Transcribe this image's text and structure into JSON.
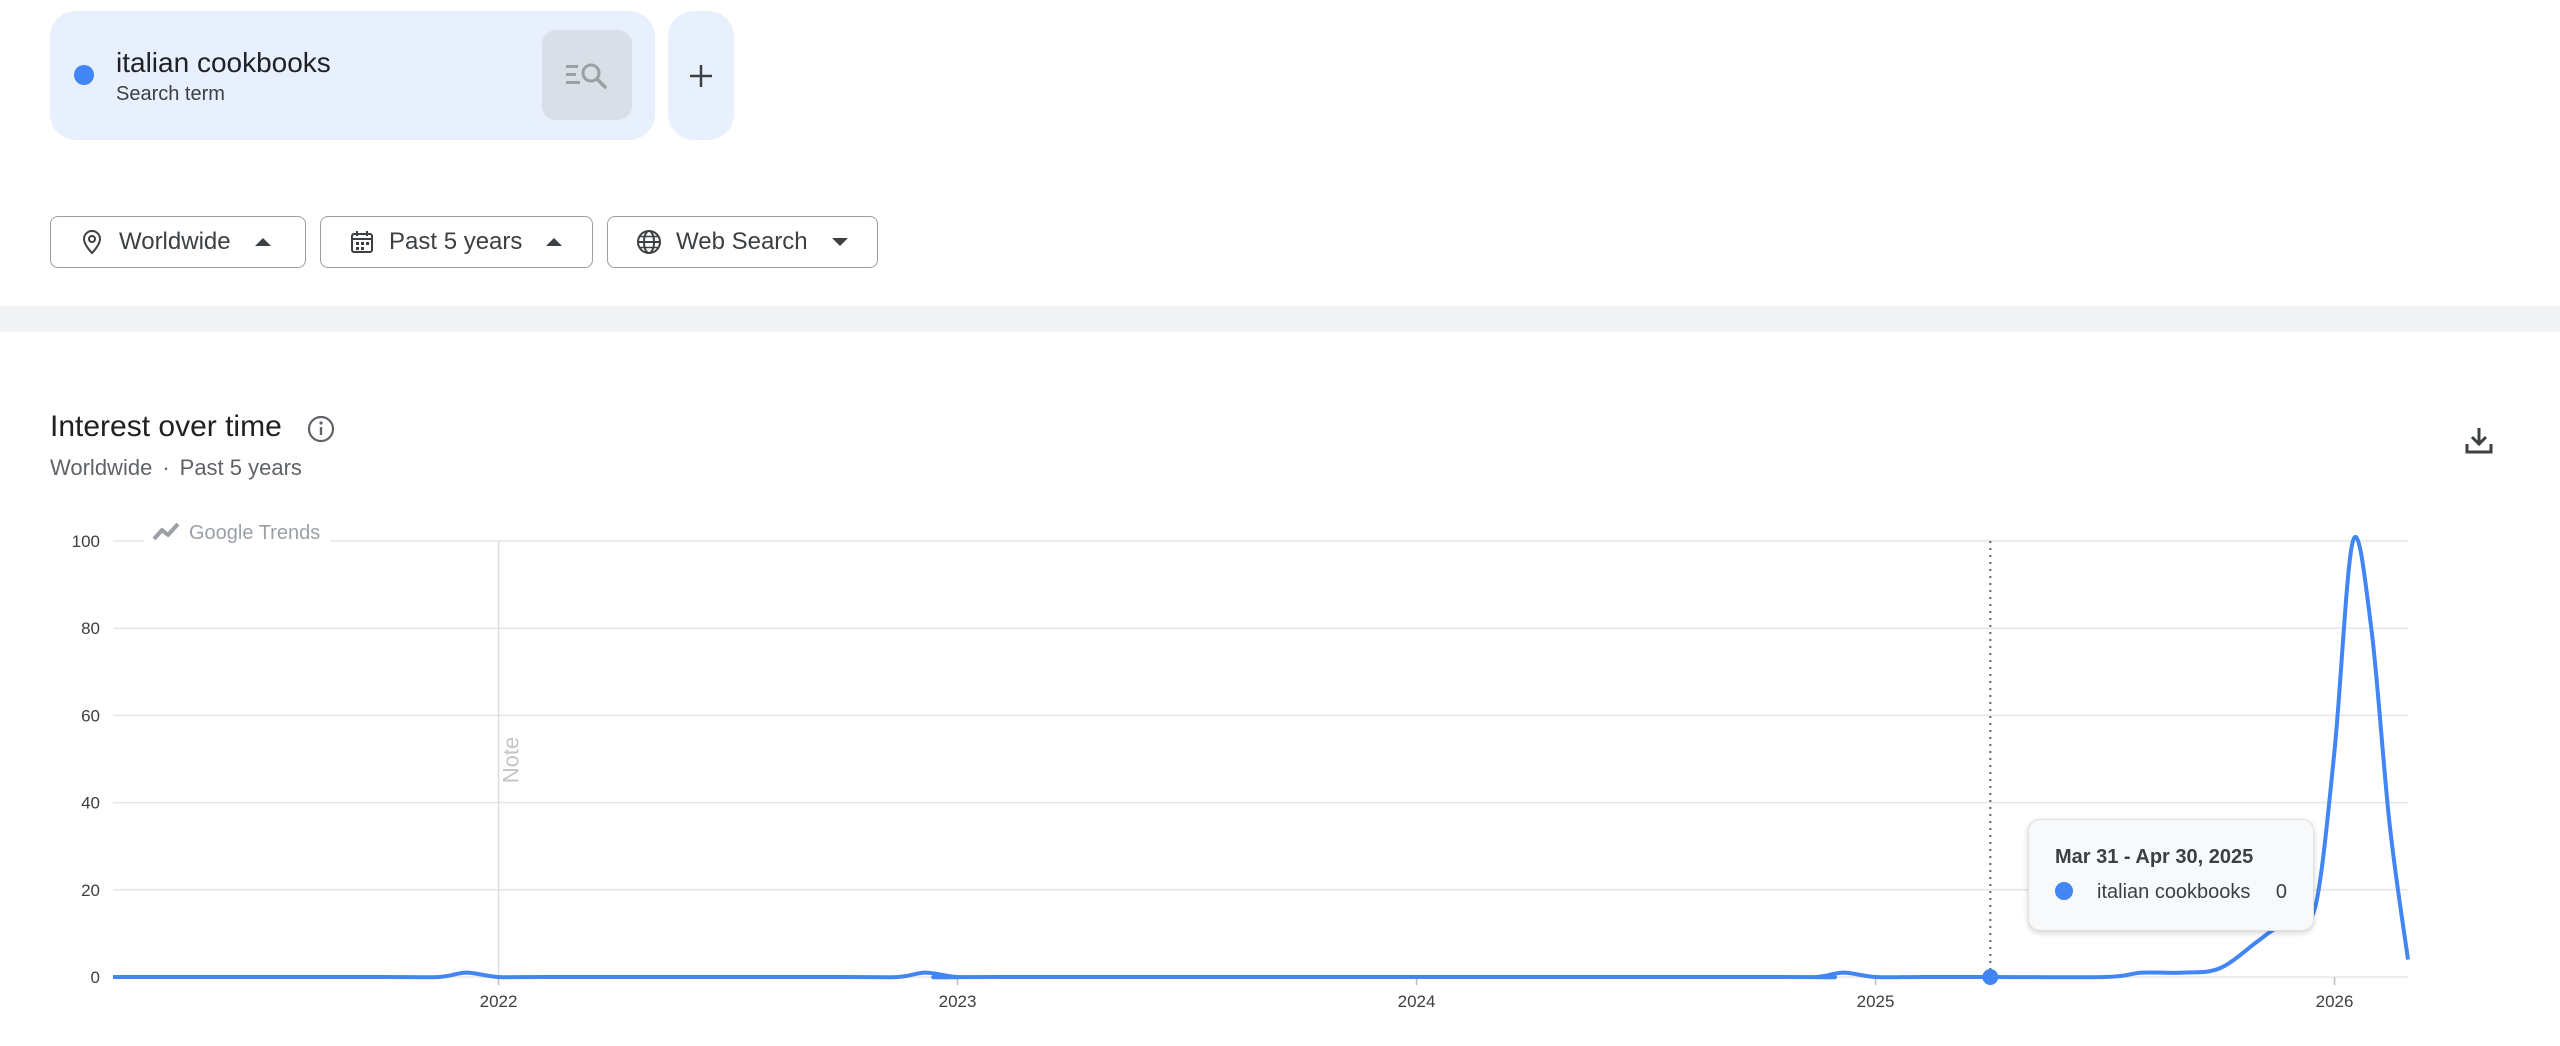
{
  "search_term": {
    "name": "italian cookbooks",
    "type": "Search term",
    "color": "#4285f4",
    "refine_icon": "query-refine-icon",
    "add_icon": "plus-icon"
  },
  "filters": {
    "region": {
      "label": "Worldwide",
      "icon": "location-pin-icon",
      "caret": "caret-up"
    },
    "time": {
      "label": "Past 5 years",
      "icon": "calendar-icon",
      "caret": "caret-up"
    },
    "property": {
      "label": "Web Search",
      "icon": "globe-icon",
      "caret": "caret-down"
    }
  },
  "section": {
    "title": "Interest over time",
    "subtitle_region": "Worldwide",
    "subtitle_sep": "·",
    "subtitle_time": "Past 5 years",
    "info_icon": "info-icon",
    "download_icon": "download-icon"
  },
  "chart_data": {
    "type": "line",
    "watermark": "Google Trends",
    "note_label": "Note",
    "note_year": 2022.0,
    "ylim": [
      0,
      100
    ],
    "y_ticks": [
      0,
      20,
      40,
      60,
      80,
      100
    ],
    "y_tick_labels": [
      "0",
      "20",
      "40",
      "60",
      "80",
      "100"
    ],
    "x_range": [
      2021.16,
      2026.16
    ],
    "x_ticks": [
      2022,
      2023,
      2024,
      2025,
      2026
    ],
    "x_tick_labels": [
      "2022",
      "2023",
      "2024",
      "2025",
      "2026"
    ],
    "grid": true,
    "series": [
      {
        "name": "italian cookbooks",
        "color": "#4285f4",
        "x": [
          2021.16,
          2021.75,
          2021.87,
          2021.93,
          2022.0,
          2022.1,
          2022.75,
          2022.87,
          2022.93,
          2023.0,
          2023.1,
          2024.75,
          2024.87,
          2024.93,
          2025.0,
          2025.1,
          2025.25,
          2025.5,
          2025.58,
          2025.67,
          2025.75,
          2025.83,
          2025.87,
          2025.92,
          2025.96,
          2026.0,
          2026.04,
          2026.08,
          2026.12,
          2026.16
        ],
        "y": [
          0,
          0,
          0,
          1,
          0,
          0,
          0,
          0,
          1,
          0,
          0,
          0,
          0,
          1,
          0,
          0,
          0,
          0,
          1,
          1,
          2,
          8,
          11,
          13,
          17,
          52,
          100,
          80,
          35,
          4
        ]
      }
    ],
    "highlight": {
      "x": 2025.25,
      "y": 0
    }
  },
  "tooltip": {
    "date": "Mar 31 - Apr 30, 2025",
    "term": "italian cookbooks",
    "value": "0"
  }
}
